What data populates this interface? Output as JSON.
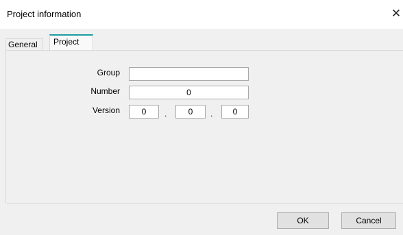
{
  "window": {
    "title": "Project information",
    "close_glyph": "✕"
  },
  "tabs": [
    {
      "label": "General",
      "active": false
    },
    {
      "label": "Project",
      "active": true
    }
  ],
  "form": {
    "group": {
      "label": "Group",
      "value": ""
    },
    "number": {
      "label": "Number",
      "value": "0"
    },
    "version": {
      "label": "Version",
      "major": "0",
      "minor": "0",
      "patch": "0",
      "separator": "."
    }
  },
  "buttons": {
    "ok": "OK",
    "cancel": "Cancel"
  },
  "colors": {
    "active_tab_accent": "#1e9ca1",
    "background": "#f0f0f0"
  }
}
